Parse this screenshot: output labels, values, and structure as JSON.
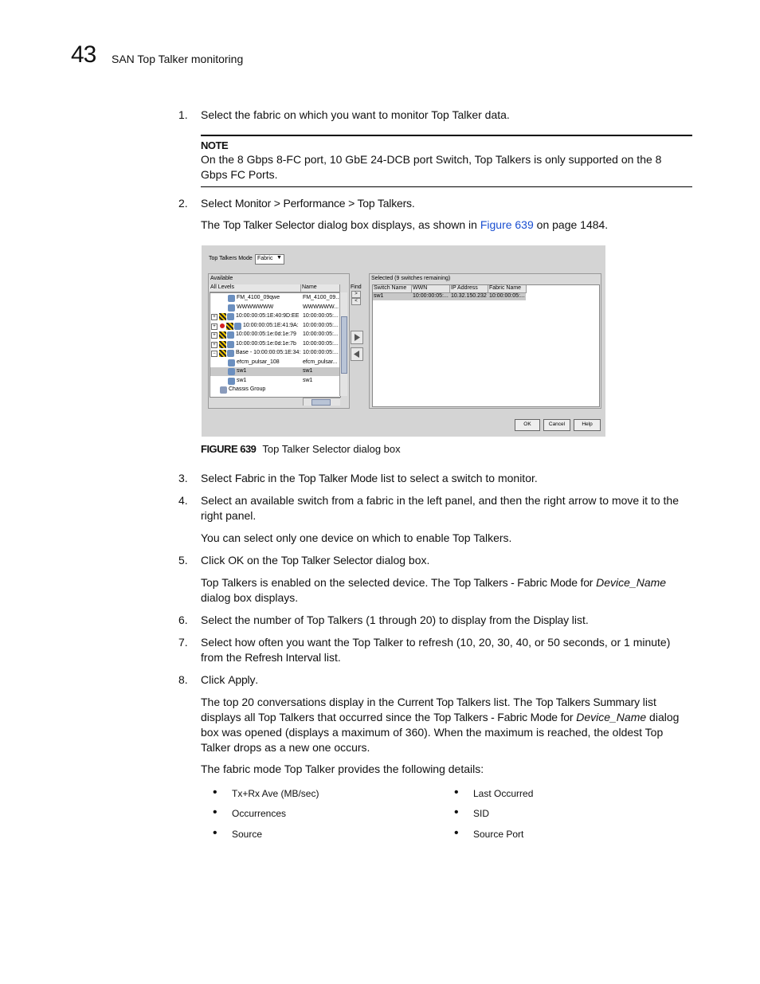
{
  "header": {
    "chapter_number": "43",
    "chapter_title": "SAN Top Talker monitoring"
  },
  "steps": [
    {
      "num": "1.",
      "text": "Select the fabric on which you want to monitor Top Talker data."
    },
    {
      "num": "2.",
      "pre": "Select ",
      "ui": "Monitor > Performance > Top Talkers",
      "post": "."
    },
    {
      "num": "3.",
      "pre": "Select ",
      "ui1": "Fabric",
      "mid": " in the ",
      "ui2": "Top Talker Mode",
      "post": " list to select a switch to monitor."
    },
    {
      "num": "4.",
      "text": "Select an available switch from a fabric in the left panel, and then the right arrow to move it to the right panel."
    },
    {
      "num": "5.",
      "pre": "Click ",
      "ui1": "OK",
      "mid": " on the ",
      "ui2": "Top Talker Selector",
      "post": " dialog box."
    },
    {
      "num": "6.",
      "pre": "Select the number of Top Talkers (1 through 20) to display from the ",
      "ui": "Display",
      "post": " list."
    },
    {
      "num": "7.",
      "pre": "Select how often you want the Top Talker to refresh (10, 20, 30, 40, or 50 seconds, or 1 minute) from the ",
      "ui": "Refresh Interval",
      "post": " list."
    },
    {
      "num": "8.",
      "pre": "Click ",
      "ui": "Apply",
      "post": "."
    }
  ],
  "note": {
    "heading": "NOTE",
    "body": "On the 8 Gbps 8-FC port, 10 GbE 24-DCB port Switch, Top Talkers is only supported on the 8 Gbps FC Ports."
  },
  "paras": {
    "selector_pre": "The ",
    "selector_ui": "Top Talker Selector",
    "selector_mid": " dialog box displays, as shown in ",
    "selector_link": "Figure 639",
    "selector_post": " on page 1484.",
    "one_device": "You can select only one device on which to enable Top Talkers.",
    "enabled_pre": "Top Talkers is enabled on the selected device. The ",
    "enabled_ui": "Top Talkers - Fabric Mode for",
    "enabled_var": "Device_Name",
    "enabled_post": "dialog box displays.",
    "top20_pre": "The top 20 conversations display in the ",
    "top20_ui1": "Current Top Talkers",
    "top20_mid": " list. The ",
    "top20_ui2": "Top Talkers Summary",
    "top20_mid2": " list displays all Top Talkers that occurred since the ",
    "top20_ui3": "Top Talkers - Fabric Mode for",
    "top20_var": "Device_Name",
    "top20_post": " dialog box was opened (displays a maximum of 360). When the maximum is reached, the oldest Top Talker drops as a new one occurs.",
    "details_intro": "The fabric mode Top Talker provides the following details:"
  },
  "details_left": [
    "Tx+Rx Ave (MB/sec)",
    "Occurrences",
    "Source"
  ],
  "details_right": [
    "Last Occurred",
    "SID",
    "Source Port"
  ],
  "figure": {
    "label": "FIGURE 639",
    "caption": "Top Talker Selector dialog box",
    "dialog": {
      "mode_label": "Top Talkers Mode",
      "mode_value": "Fabric",
      "available_title": "Available",
      "col_all_levels": "All Levels",
      "col_name": "Name",
      "find_label": "Find",
      "tree_rows": [
        {
          "label": "FM_4100_09qwe",
          "name": "FM_4100_09..."
        },
        {
          "label": "WWWWWWW",
          "name": "WWWWWW..."
        },
        {
          "label": "10:00:00:05:1E:40:9D:EE",
          "name": "10:00:00:05:..."
        },
        {
          "label": "10:00:00:05:1E:41:9A:",
          "name": "10:00:00:05:..."
        },
        {
          "label": "10:00:00:05:1e:0d:1e:79",
          "name": "10:00:00:05:..."
        },
        {
          "label": "10:00:00:05:1e:0d:1e:7b",
          "name": "10:00:00:05:..."
        },
        {
          "label": "Base - 10:00:00:05:1E:34:",
          "name": "10:00:00:05:..."
        },
        {
          "label": "efcm_pulsar_108",
          "name": "efcm_pulsar..."
        },
        {
          "label": "sw1",
          "name": "sw1"
        },
        {
          "label": "sw1",
          "name": "sw1"
        },
        {
          "label": "Chassis Group",
          "name": ""
        }
      ],
      "selected_title": "Selected (9 switches remaining)",
      "selected_columns": [
        "Switch Name",
        "WWN",
        "IP Address",
        "Fabric Name"
      ],
      "selected_rows": [
        [
          "sw1",
          "10:00:00:05:...",
          "10.32.150.232",
          "10:00:00:05:..."
        ]
      ],
      "ok_label": "OK",
      "cancel_label": "Cancel",
      "help_label": "Help"
    }
  }
}
